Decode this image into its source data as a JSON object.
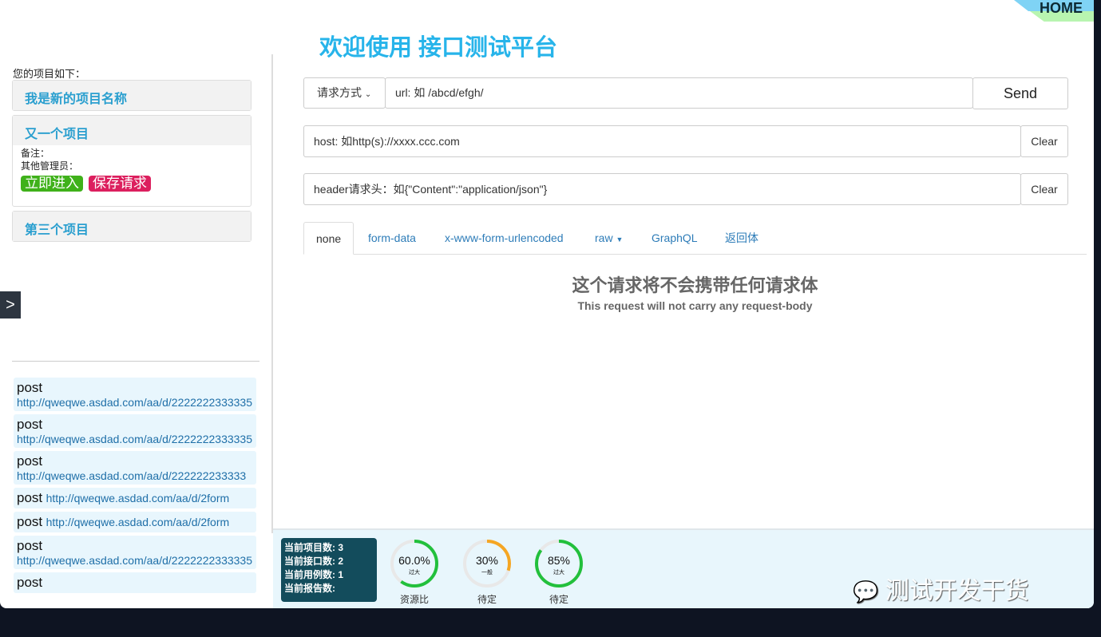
{
  "home": "HOME",
  "title": "欢迎使用 接口测试平台",
  "sidebar": {
    "label": "您的项目如下：",
    "projects": [
      {
        "name": "我是新的项目名称"
      },
      {
        "name": "又一个项目",
        "note": "备注：",
        "admins": "其他管理员：",
        "enter": "立即进入",
        "save": "保存请求"
      },
      {
        "name": "第三个项目"
      }
    ],
    "toggle": ">",
    "requests": [
      {
        "method": "post",
        "url": "http://qweqwe.asdad.com/aa/d/2222222333335"
      },
      {
        "method": "post",
        "url": "http://qweqwe.asdad.com/aa/d/2222222333335"
      },
      {
        "method": "post",
        "url": "http://qweqwe.asdad.com/aa/d/222222233333"
      },
      {
        "method": "post",
        "url": "http://qweqwe.asdad.com/aa/d/2form"
      },
      {
        "method": "post",
        "url": "http://qweqwe.asdad.com/aa/d/2form"
      },
      {
        "method": "post",
        "url": "http://qweqwe.asdad.com/aa/d/2222222333335"
      },
      {
        "method": "post",
        "url": ""
      }
    ]
  },
  "request": {
    "method": "请求方式",
    "url_placeholder": "url: 如 /abcd/efgh/",
    "send": "Send",
    "host_placeholder": "host: 如http(s)://xxxx.ccc.com",
    "header_placeholder": "header请求头：如{\"Content\":\"application/json\"}",
    "clear": "Clear"
  },
  "tabs": [
    "none",
    "form-data",
    "x-www-form-urlencoded",
    "raw",
    "GraphQL",
    "返回体"
  ],
  "empty": {
    "title": "这个请求将不会携带任何请求体",
    "subtitle": "This request will not carry any request-body"
  },
  "footer": {
    "stats": [
      "当前项目数: 3",
      "当前接口数: 2",
      "当前用例数: 1",
      "当前报告数:"
    ],
    "gauges": [
      {
        "value": "60.0%",
        "fraction": 0.6,
        "sub": "过大",
        "label": "资源比",
        "color": "#22c03c"
      },
      {
        "value": "30%",
        "fraction": 0.3,
        "sub": "一般",
        "label": "待定",
        "color": "#f5a623"
      },
      {
        "value": "85%",
        "fraction": 0.85,
        "sub": "过大",
        "label": "待定",
        "color": "#22c03c"
      }
    ]
  },
  "watermark": "测试开发干货"
}
